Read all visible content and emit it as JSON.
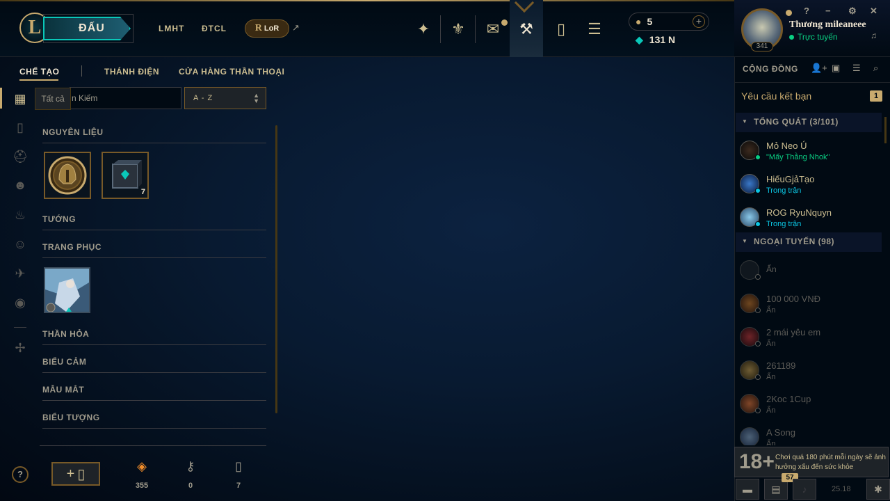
{
  "nav": {
    "play_label": "ĐẤU",
    "links": [
      "LMHT",
      "ĐTCL"
    ],
    "lor_label": "LoR",
    "lor_symbol": "R",
    "ext_symbol": "↗",
    "icons": [
      "home-icon",
      "profile-icon",
      "collection-icon",
      "loot-icon",
      "collection-icon",
      "store-icon"
    ]
  },
  "currency": {
    "rp": "5",
    "be": "131 N",
    "add_symbol": "+"
  },
  "profile": {
    "name": "Thương mileaneee",
    "status": "Trực tuyến",
    "level": "341"
  },
  "window": {
    "help": "?",
    "minimize": "−",
    "settings": "⚙",
    "close": "✕"
  },
  "subnav": {
    "tabs": [
      "CHẾ TẠO",
      "THÁNH ĐIỆN",
      "CỬA HÀNG THẦN THOẠI"
    ],
    "active": "CHẾ TẠO"
  },
  "filter": {
    "tooltip": "Tất cả",
    "search_text": "n Kiếm",
    "sort_label": "A - Z"
  },
  "sections": {
    "materials": "NGUYÊN LIỆU",
    "champions": "TƯỚNG",
    "skins": "TRANG PHỤC",
    "ward": "THẦN HỎA",
    "emotes": "BIỂU CẢM",
    "eyes": "MẪU MẮT",
    "icons": "BIỂU TƯỢNG"
  },
  "items": {
    "chest_count": "7"
  },
  "bottom": {
    "craft_plus": "+",
    "essence": "355",
    "keys": "0",
    "chests": "7",
    "help": "?"
  },
  "social": {
    "header": "CỘNG ĐỒNG",
    "friend_requests": "Yêu cầu kết bạn",
    "friend_requests_count": "1",
    "group_general": "TỔNG QUÁT (3/101)",
    "group_offline": "NGOẠI TUYẾN (98)",
    "online_friends": [
      {
        "name": "Mỏ Neo Ú",
        "status": "\"Mấy Thằng Nhok\""
      },
      {
        "name": "HiếuGjảTạo",
        "status": "Trong trận"
      },
      {
        "name": "ROG RyuNquyn",
        "status": "Trong trận"
      }
    ],
    "offline_friends": [
      {
        "name": "Ẩn",
        "status": ""
      },
      {
        "name": "100 000 VNĐ",
        "status": "Ẩn"
      },
      {
        "name": "2 mái yêu em",
        "status": "Ẩn"
      },
      {
        "name": "261189",
        "status": "Ẩn"
      },
      {
        "name": "2Koc 1Cup",
        "status": "Ẩn"
      },
      {
        "name": "A Song",
        "status": "Ẩn"
      }
    ]
  },
  "warning": {
    "age": "18+",
    "text": "Chơi quá 180 phút mỗi ngày sẽ ảnh hưởng xấu đến sức khỏe"
  },
  "footer": {
    "notif_count": "57",
    "version": "25.18"
  },
  "colors": {
    "gold": "#c8aa6e",
    "teal": "#0ac8b9",
    "online": "#0acf83",
    "in_game": "#0bc6e3"
  }
}
